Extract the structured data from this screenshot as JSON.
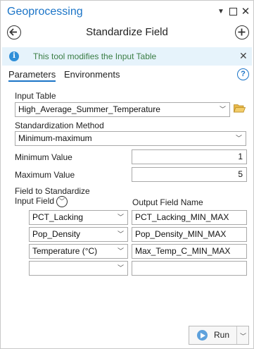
{
  "window": {
    "title": "Geoprocessing"
  },
  "header": {
    "title": "Standardize Field"
  },
  "banner": {
    "text": "This tool modifies the Input Table"
  },
  "tabs": [
    {
      "label": "Parameters",
      "active": true
    },
    {
      "label": "Environments",
      "active": false
    }
  ],
  "params": {
    "input_table": {
      "label": "Input Table",
      "value": "High_Average_Summer_Temperature"
    },
    "method": {
      "label": "Standardization Method",
      "value": "Minimum-maximum"
    },
    "min_value": {
      "label": "Minimum Value",
      "value": "1"
    },
    "max_value": {
      "label": "Maximum Value",
      "value": "5"
    },
    "fields": {
      "label": "Field to Standardize",
      "col_input": "Input Field",
      "col_output": "Output Field Name",
      "rows": [
        {
          "input": "PCT_Lacking",
          "output": "PCT_Lacking_MIN_MAX"
        },
        {
          "input": "Pop_Density",
          "output": "Pop_Density_MIN_MAX"
        },
        {
          "input": "Temperature (°C)",
          "output": "Max_Temp_C_MIN_MAX"
        },
        {
          "input": "",
          "output": ""
        }
      ]
    }
  },
  "footer": {
    "run_label": "Run"
  },
  "colors": {
    "accent": "#1b74c7",
    "banner_bg": "#e6f3fb",
    "banner_text": "#3a7d44",
    "run_icon": "#5ea1dc"
  },
  "icons": [
    "back-arrow-icon",
    "add-icon",
    "info-icon",
    "close-icon",
    "help-icon",
    "folder-icon",
    "chevron-down-icon",
    "play-icon"
  ]
}
